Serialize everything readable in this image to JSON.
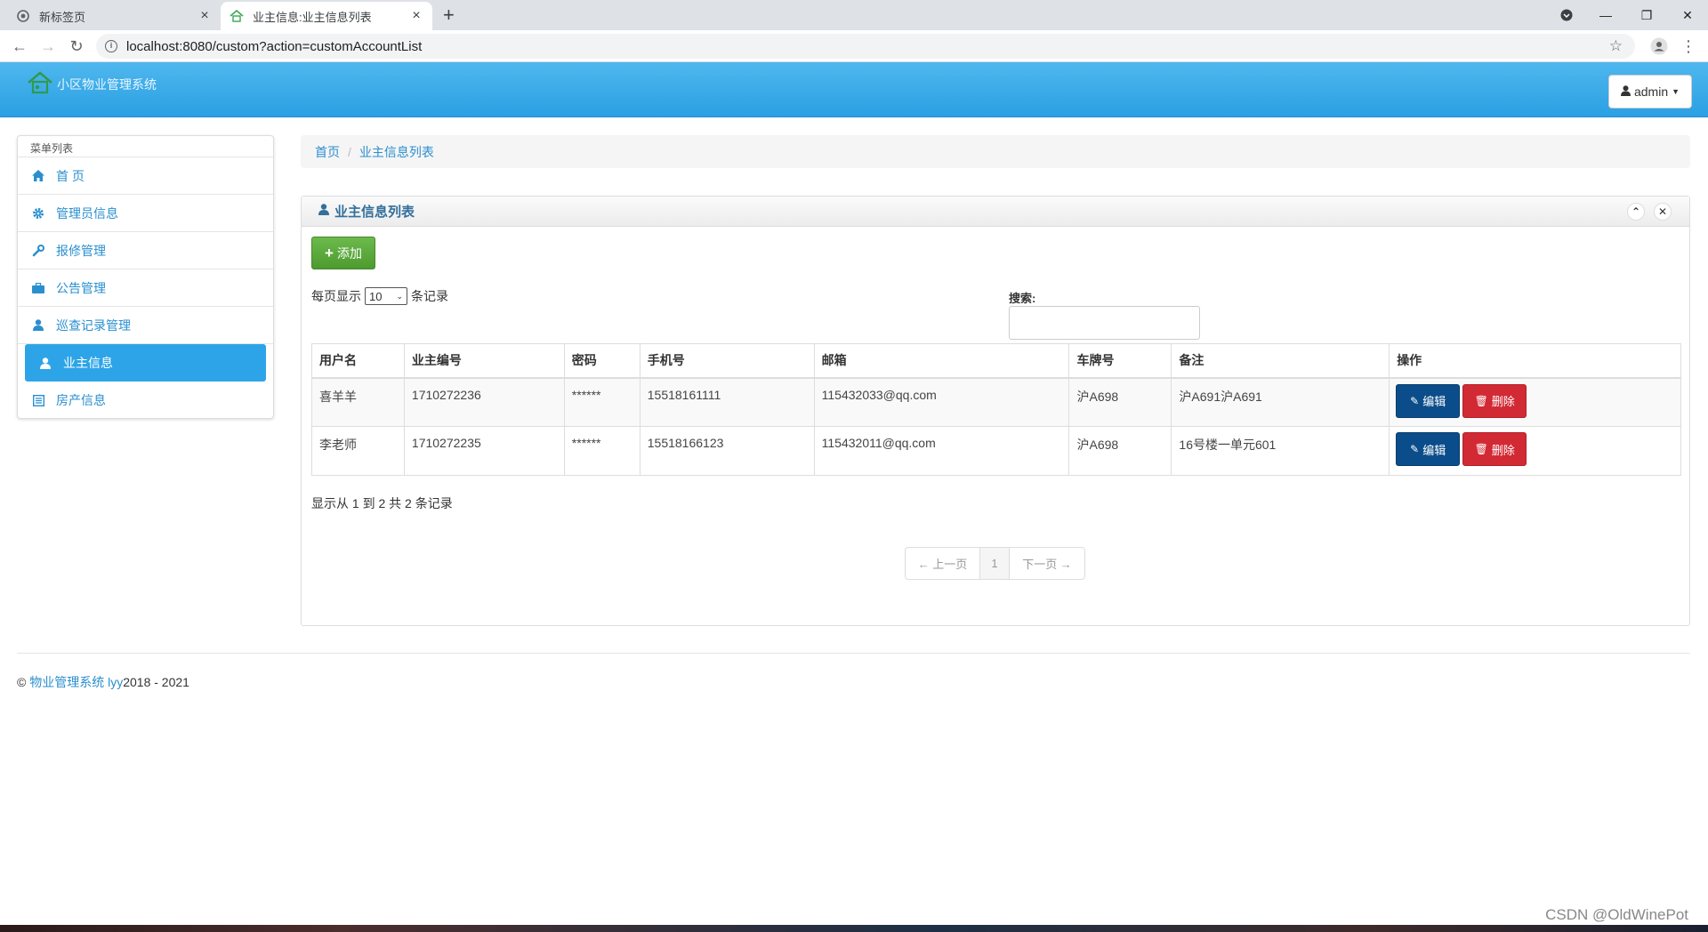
{
  "browser": {
    "tabs": [
      {
        "title": "新标签页",
        "active": false
      },
      {
        "title": "业主信息:业主信息列表",
        "active": true
      }
    ],
    "url": "localhost:8080/custom?action=customAccountList"
  },
  "app": {
    "brand": "小区物业管理系统",
    "user": "admin"
  },
  "sidebar": {
    "heading": "菜单列表",
    "items": [
      {
        "label": "首 页",
        "icon": "home-icon",
        "active": false
      },
      {
        "label": "管理员信息",
        "icon": "gear-icon",
        "active": false
      },
      {
        "label": "报修管理",
        "icon": "wrench-icon",
        "active": false
      },
      {
        "label": "公告管理",
        "icon": "briefcase-icon",
        "active": false
      },
      {
        "label": "巡查记录管理",
        "icon": "user-icon",
        "active": false
      },
      {
        "label": "业主信息",
        "icon": "user-icon",
        "active": true
      },
      {
        "label": "房产信息",
        "icon": "list-icon",
        "active": false
      }
    ]
  },
  "breadcrumb": {
    "home": "首页",
    "current": "业主信息列表"
  },
  "panel": {
    "title": "业主信息列表",
    "add_label": "添加",
    "length_prefix": "每页显示",
    "length_value": "10",
    "length_suffix": "条记录",
    "search_label": "搜索:",
    "columns": [
      "用户名",
      "业主编号",
      "密码",
      "手机号",
      "邮箱",
      "车牌号",
      "备注",
      "操作"
    ],
    "rows": [
      {
        "username": "喜羊羊",
        "id": "1710272236",
        "password": "******",
        "phone": "15518161111",
        "email": "115432033@qq.com",
        "plate": "沪A698",
        "note": "沪A691沪A691"
      },
      {
        "username": "李老师",
        "id": "1710272235",
        "password": "******",
        "phone": "15518166123",
        "email": "115432011@qq.com",
        "plate": "沪A698",
        "note": "16号楼一单元601"
      }
    ],
    "edit_label": "编辑",
    "delete_label": "删除",
    "info": "显示从 1 到 2 共 2 条记录",
    "pager": {
      "prev": "← 上一页",
      "page": "1",
      "next": "下一页 →"
    }
  },
  "footer": {
    "copyright": "©",
    "link": "物业管理系统 lyy",
    "years": "2018 - 2021"
  },
  "watermark": "CSDN @OldWinePot",
  "colors": {
    "header": "#2aa0e3",
    "active_nav": "#2ea4e8",
    "add": "#5aa63a",
    "edit": "#0b4d8a",
    "delete": "#d22a34",
    "link": "#2a8fcf"
  }
}
